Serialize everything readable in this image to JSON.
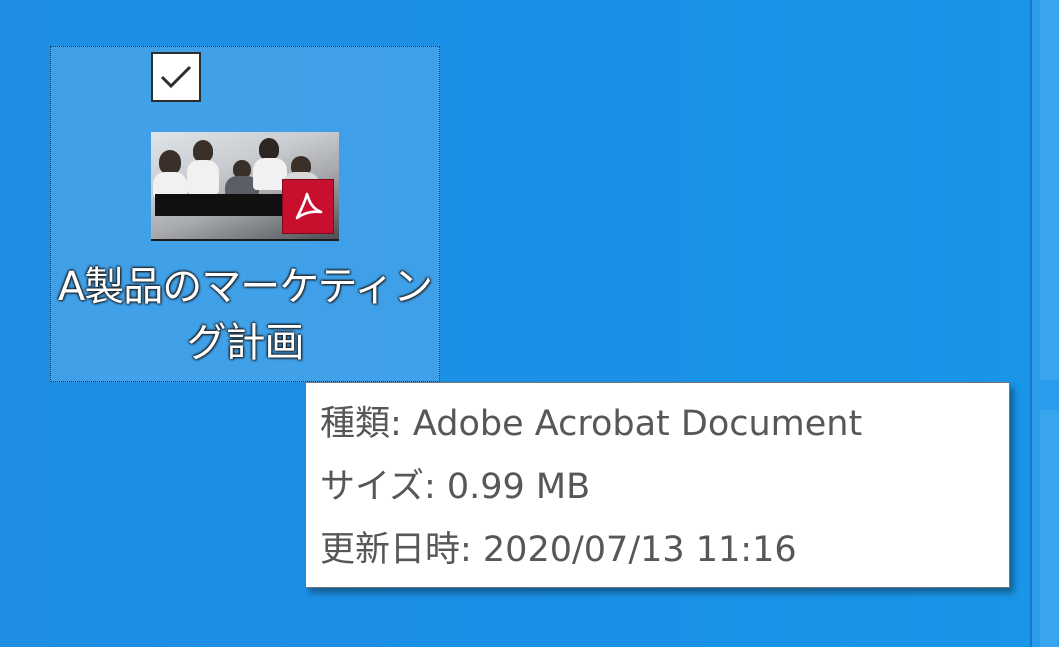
{
  "desktop": {
    "file_icon": {
      "name": "A製品のマーケティング計画",
      "name_line1": "A製品のマーケティン",
      "name_line2": "グ計画",
      "selected": true,
      "checkbox_checked": true,
      "thumbnail_icon": "pdf-document-thumbnail",
      "badge_icon": "adobe-acrobat-icon"
    }
  },
  "tooltip": {
    "type_label": "種類: Adobe Acrobat Document",
    "size_label": "サイズ: 0.99 MB",
    "modified_label": "更新日時: 2020/07/13 11:16"
  },
  "colors": {
    "desktop_background": "#1a90e6",
    "selection_fill": "#78bef0",
    "pdf_badge": "#c8102e",
    "tooltip_text": "#575757"
  }
}
